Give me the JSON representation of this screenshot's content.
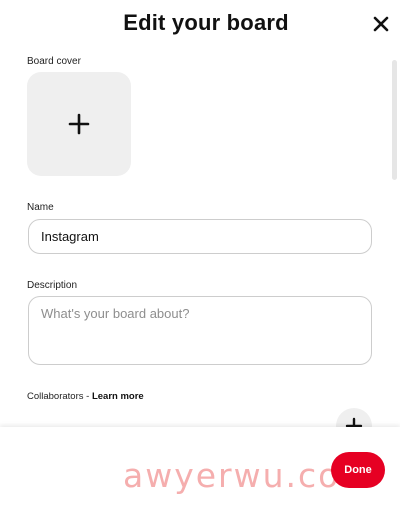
{
  "modal": {
    "title": "Edit your board",
    "close_icon": "close-icon"
  },
  "cover": {
    "label": "Board cover",
    "add_icon": "plus-icon"
  },
  "name": {
    "label": "Name",
    "value": "Instagram"
  },
  "description": {
    "label": "Description",
    "placeholder": "What's your board about?"
  },
  "collaborators": {
    "label": "Collaborators - ",
    "learn_more": "Learn more",
    "add_icon": "plus-icon"
  },
  "footer": {
    "done_label": "Done"
  },
  "watermark": "awyerwu.com",
  "colors": {
    "accent": "#e60023",
    "tile_bg": "#efefef",
    "border": "#cdcdcd"
  }
}
